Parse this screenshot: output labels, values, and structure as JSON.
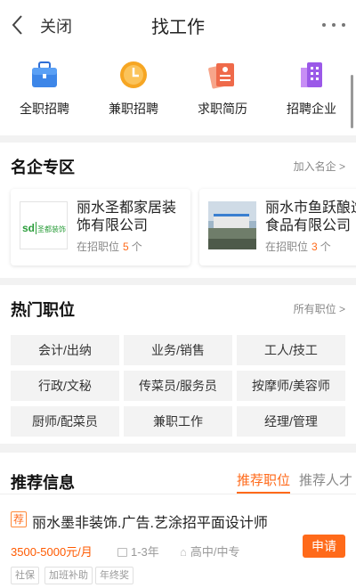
{
  "header": {
    "close_label": "关闭",
    "title": "找工作"
  },
  "quick_menu": [
    {
      "label": "全职招聘",
      "icon": "briefcase-icon"
    },
    {
      "label": "兼职招聘",
      "icon": "clock-icon"
    },
    {
      "label": "求职简历",
      "icon": "resume-icon"
    },
    {
      "label": "招聘企业",
      "icon": "building-icon"
    }
  ],
  "companies": {
    "title": "名企专区",
    "more": "加入名企 >",
    "items": [
      {
        "name": "丽水圣都家居装饰有限公司",
        "hiring_label": "在招职位",
        "count": "5",
        "unit": "个",
        "logo_text": "圣都装饰"
      },
      {
        "name": "丽水市鱼跃酿造食品有限公司",
        "hiring_label": "在招职位",
        "count": "3",
        "unit": "个"
      }
    ]
  },
  "hot_jobs": {
    "title": "热门职位",
    "more": "所有职位 >",
    "items": [
      "会计/出纳",
      "业务/销售",
      "工人/技工",
      "行政/文秘",
      "传菜员/服务员",
      "按摩师/美容师",
      "厨师/配菜员",
      "兼职工作",
      "经理/管理"
    ]
  },
  "recommend": {
    "title": "推荐信息",
    "tabs": [
      "推荐职位",
      "推荐人才"
    ],
    "job": {
      "badge": "荐",
      "title": "丽水墨非装饰.广告.艺涂招平面设计师",
      "salary": "3500-5000元/月",
      "experience": "1-3年",
      "education": "高中/中专",
      "apply": "申请",
      "tags": [
        "社保",
        "加班补助",
        "年终奖"
      ]
    }
  },
  "colors": {
    "accent": "#ff6a1a"
  }
}
